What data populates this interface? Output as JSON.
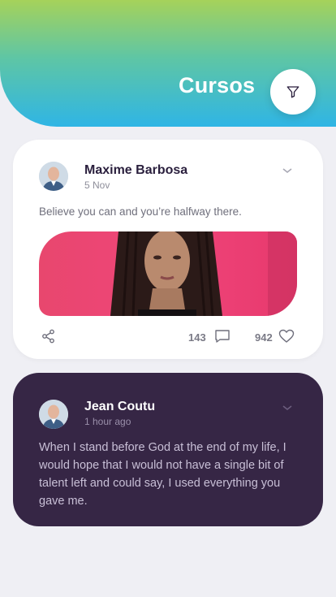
{
  "header": {
    "title": "Cursos",
    "filter_icon": "filter-icon"
  },
  "posts": [
    {
      "author": "Maxime Barbosa",
      "date": "5 Nov",
      "text": "Believe you can and you’re halfway there.",
      "comments": "143",
      "likes": "942",
      "icons": [
        "avatar",
        "chevron-down-icon",
        "share-icon",
        "comment-icon",
        "heart-icon"
      ]
    },
    {
      "author": "Jean Coutu",
      "date": "1 hour ago",
      "text": "When I stand before God at the end of my life, I would hope that I would not have a single bit of talent left and could say, I used everything you gave me.",
      "icons": [
        "avatar",
        "chevron-down-icon"
      ]
    }
  ],
  "colors": {
    "header_gradient": [
      "#a6d25a",
      "#5fc6a4",
      "#2fb5e5"
    ],
    "dark_card": "#362645",
    "background": "#efeff4"
  }
}
